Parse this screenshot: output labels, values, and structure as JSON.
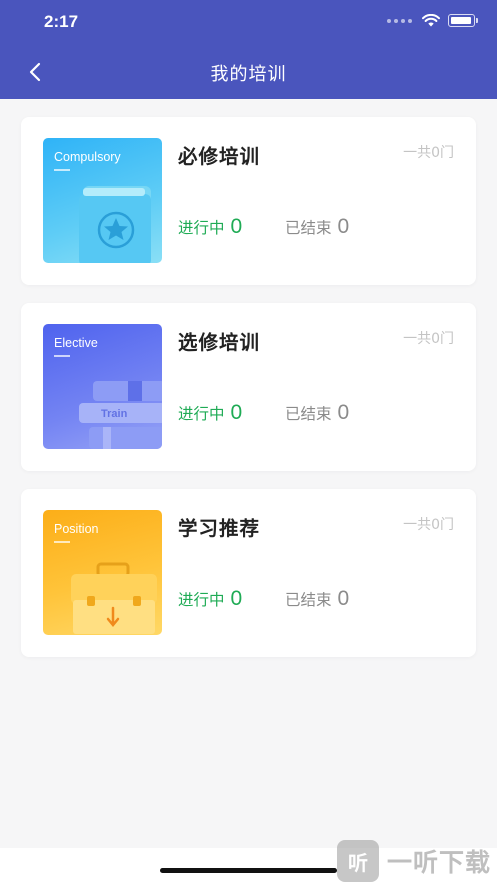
{
  "status_bar": {
    "time": "2:17"
  },
  "header": {
    "title": "我的培训"
  },
  "cards": [
    {
      "thumb_label": "Compulsory",
      "title": "必修培训",
      "total": "一共0门",
      "ongoing_label": "进行中",
      "ongoing_count": "0",
      "ended_label": "已结束",
      "ended_count": "0"
    },
    {
      "thumb_label": "Elective",
      "thumb_caption": "Train",
      "title": "选修培训",
      "total": "一共0门",
      "ongoing_label": "进行中",
      "ongoing_count": "0",
      "ended_label": "已结束",
      "ended_count": "0"
    },
    {
      "thumb_label": "Position",
      "title": "学习推荐",
      "total": "一共0门",
      "ongoing_label": "进行中",
      "ongoing_count": "0",
      "ended_label": "已结束",
      "ended_count": "0"
    }
  ],
  "watermark": {
    "logo_glyph": "听",
    "text": "一听下载"
  },
  "colors": {
    "header_bg": "#4a55bd",
    "ongoing": "#1fab55",
    "ended": "#8b8b8b",
    "compulsory_gradient": [
      "#2fb8f5",
      "#7fdcf7"
    ],
    "elective_gradient": [
      "#5a6cf0",
      "#8c99f5"
    ],
    "position_gradient": [
      "#fdb21c",
      "#ffd257"
    ]
  },
  "icons": [
    "back-chevron-icon",
    "wifi-icon",
    "battery-icon",
    "book-star-icon",
    "book-stack-icon",
    "briefcase-icon"
  ]
}
